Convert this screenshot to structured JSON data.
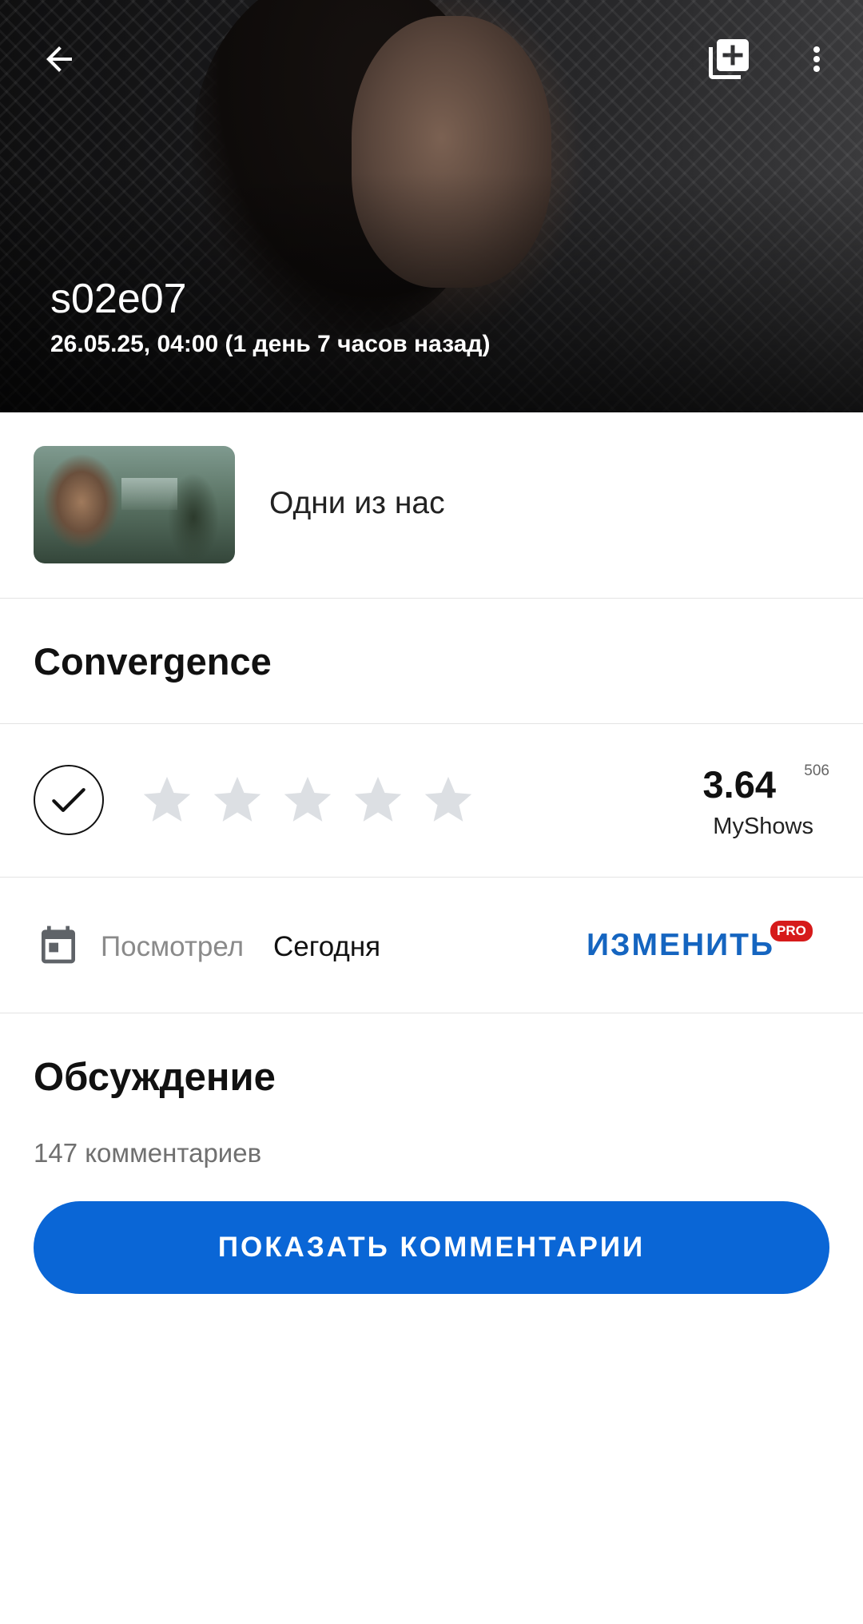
{
  "hero": {
    "episode_code": "s02e07",
    "air_date": "26.05.25, 04:00 (1 день 7 часов назад)"
  },
  "toolbar": {
    "back_icon": "arrow-left-icon",
    "add_icon": "library-add-icon",
    "menu_icon": "more-vertical-icon"
  },
  "show": {
    "name": "Одни из нас"
  },
  "episode": {
    "title": "Convergence"
  },
  "rating": {
    "user_stars": 0,
    "max_stars": 5,
    "score": "3.64",
    "votes": "506",
    "source": "MyShows",
    "star_color_empty": "#dcdfe3"
  },
  "watched": {
    "label": "Посмотрел",
    "value": "Сегодня",
    "change_label": "ИЗМЕНИТЬ",
    "pro_badge": "PRO"
  },
  "discussion": {
    "title": "Обсуждение",
    "count": "147 комментариев",
    "button_label": "ПОКАЗАТЬ КОММЕНТАРИИ"
  },
  "colors": {
    "accent": "#0a66d6",
    "link": "#1565c0",
    "pro": "#d61a1a"
  }
}
